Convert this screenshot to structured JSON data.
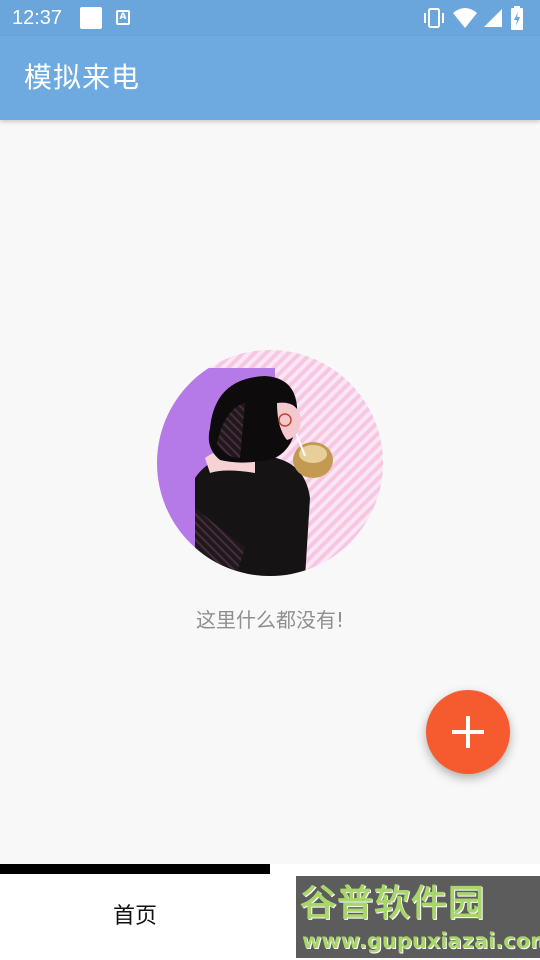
{
  "status_bar": {
    "time": "12:37",
    "notification_icons": [
      "blank-square-icon",
      "a-icon"
    ],
    "notification_a_label": "A",
    "system_icons": [
      "vibrate-icon",
      "wifi-icon",
      "signal-icon",
      "battery-charging-icon"
    ],
    "background_color": "#6aa5dc"
  },
  "app_bar": {
    "title": "模拟来电",
    "background_color": "#6ea9df"
  },
  "empty_state": {
    "illustration": "girl-drinking-coconut-illustration",
    "message": "这里什么都没有!"
  },
  "fab": {
    "icon": "plus-icon",
    "color": "#f65a2f"
  },
  "bottom_nav": {
    "tabs": [
      {
        "label": "首页",
        "selected": true
      },
      {
        "label": "",
        "selected": false
      }
    ]
  },
  "watermark": {
    "main_text": "谷普软件园",
    "url": "www.gupuxiazai.com"
  }
}
